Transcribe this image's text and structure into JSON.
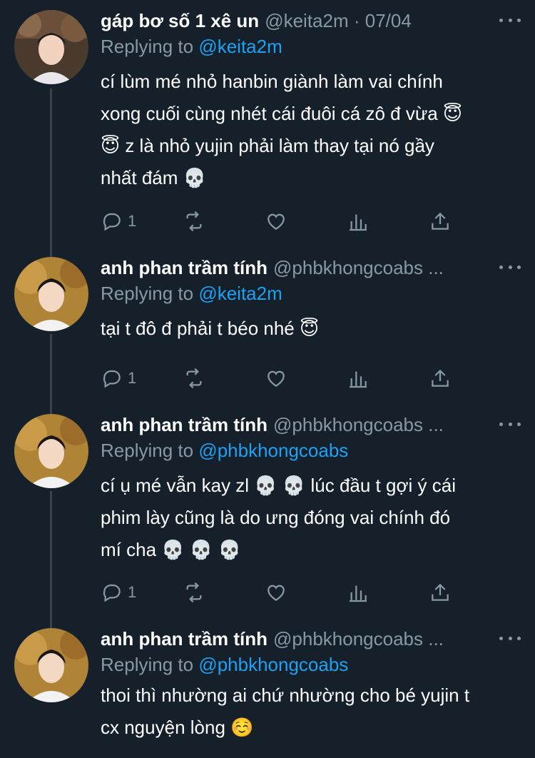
{
  "tweets": [
    {
      "name": "gáp bơ số 1 xê un",
      "meta": "@keita2m · 07/04",
      "replying_prefix": "Replying to",
      "replying_handle": "@keita2m",
      "lines": [
        "cí lùm mé nhỏ hanbin giành làm vai chính",
        "xong cuối cùng nhét cái đuôi cá zô đ vừa 😇",
        "😇  z là nhỏ yujin phải làm thay tại nó gầy",
        "nhất đám 💀"
      ],
      "reply_count": "1"
    },
    {
      "name": "anh phan trầm tính",
      "meta": "@phbkhongcoabs ...",
      "replying_prefix": "Replying to",
      "replying_handle": "@keita2m",
      "lines": [
        "tại t đô đ phải t béo nhé 😇"
      ],
      "reply_count": "1"
    },
    {
      "name": "anh phan trầm tính",
      "meta": "@phbkhongcoabs ...",
      "replying_prefix": "Replying to",
      "replying_handle": "@phbkhongcoabs",
      "lines": [
        "cí ụ mé vẫn kay zl 💀 💀  lúc đầu t gợi ý cái",
        "phim lày cũng là do ưng đóng vai chính đó",
        "mí cha 💀 💀 💀"
      ],
      "reply_count": "1"
    },
    {
      "name": "anh phan trầm tính",
      "meta": "@phbkhongcoabs ...",
      "replying_prefix": "Replying to",
      "replying_handle": "@phbkhongcoabs",
      "lines": [
        "thoi thì nhường ai chứ nhường cho bé yujin t",
        "cx nguyện lòng ☺️"
      ],
      "reply_count": ""
    }
  ],
  "icons": [
    "reply-icon",
    "retweet-icon",
    "like-icon",
    "analytics-icon",
    "share-icon",
    "more-icon"
  ],
  "colors": {
    "background": "#15202b",
    "secondary_text": "#8899a6",
    "link": "#1da1f2",
    "thread_line": "#38444d"
  }
}
